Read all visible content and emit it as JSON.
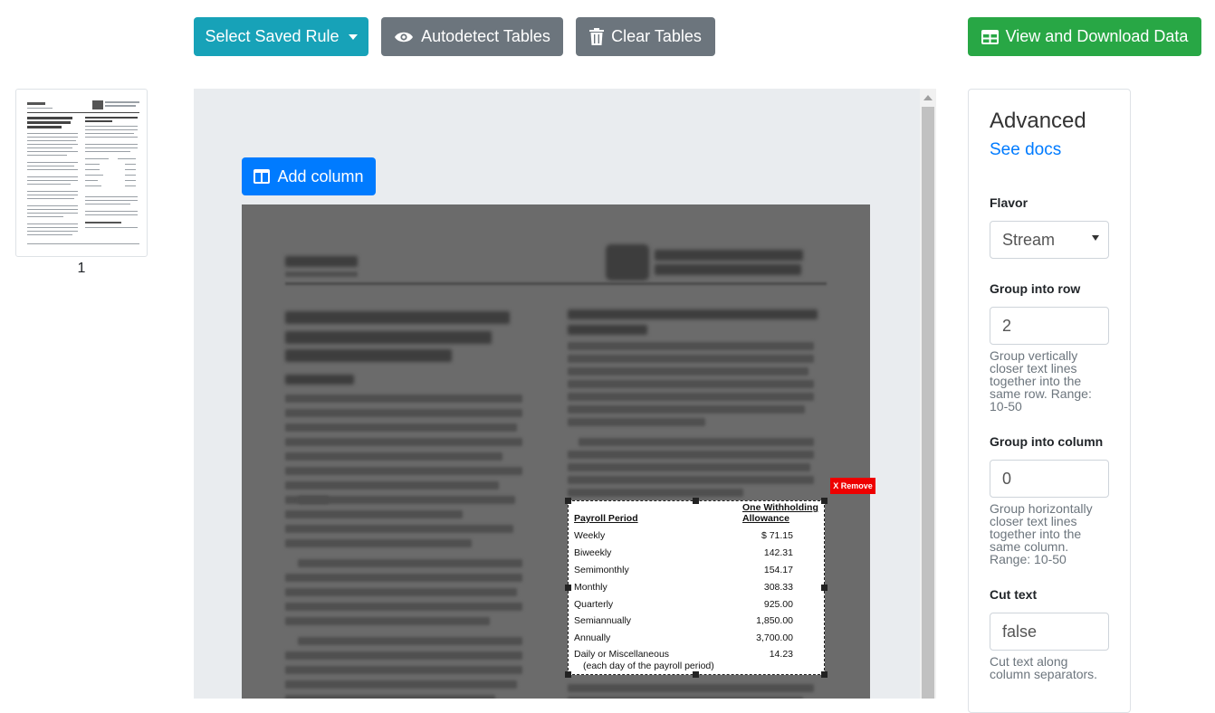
{
  "toolbar": {
    "select_rule_label": "Select Saved Rule",
    "autodetect_label": "Autodetect Tables",
    "clear_label": "Clear Tables",
    "view_download_label": "View and Download Data"
  },
  "thumbnails": {
    "page_number": "1"
  },
  "viewer": {
    "add_column_label": "Add column",
    "remove_label": "X Remove"
  },
  "selection_table": {
    "header_period": "Payroll Period",
    "header_allowance_line1": "One Withholding",
    "header_allowance_line2": "Allowance",
    "rows": [
      {
        "period": "Weekly",
        "value": "$   71.15"
      },
      {
        "period": "Biweekly",
        "value": "142.31"
      },
      {
        "period": "Semimonthly",
        "value": "154.17"
      },
      {
        "period": "Monthly",
        "value": "308.33"
      },
      {
        "period": "Quarterly",
        "value": "925.00"
      },
      {
        "period": "Semiannually",
        "value": "1,850.00"
      },
      {
        "period": "Annually",
        "value": "3,700.00"
      },
      {
        "period": "Daily or Miscellaneous",
        "value": "14.23"
      }
    ],
    "footnote": "(each day of the payroll period)"
  },
  "panel": {
    "title": "Advanced",
    "docs_link": "See docs",
    "flavor_label": "Flavor",
    "flavor_value": "Stream",
    "group_row_label": "Group into row",
    "group_row_value": "2",
    "group_row_help": "Group vertically closer text lines together into the same row. Range: 10-50",
    "group_col_label": "Group into column",
    "group_col_value": "0",
    "group_col_help": "Group horizontally closer text lines together into the same column. Range: 10-50",
    "cut_text_label": "Cut text",
    "cut_text_value": "false",
    "cut_text_help": "Cut text along column separators."
  },
  "colors": {
    "info": "#17a2b8",
    "secondary": "#6c757d",
    "success": "#28a745",
    "primary": "#007bff",
    "danger": "#ee0000"
  },
  "icons": [
    "caret-down-icon",
    "eye-icon",
    "trash-icon",
    "table-icon",
    "columns-icon",
    "scroll-up-arrow-icon"
  ]
}
